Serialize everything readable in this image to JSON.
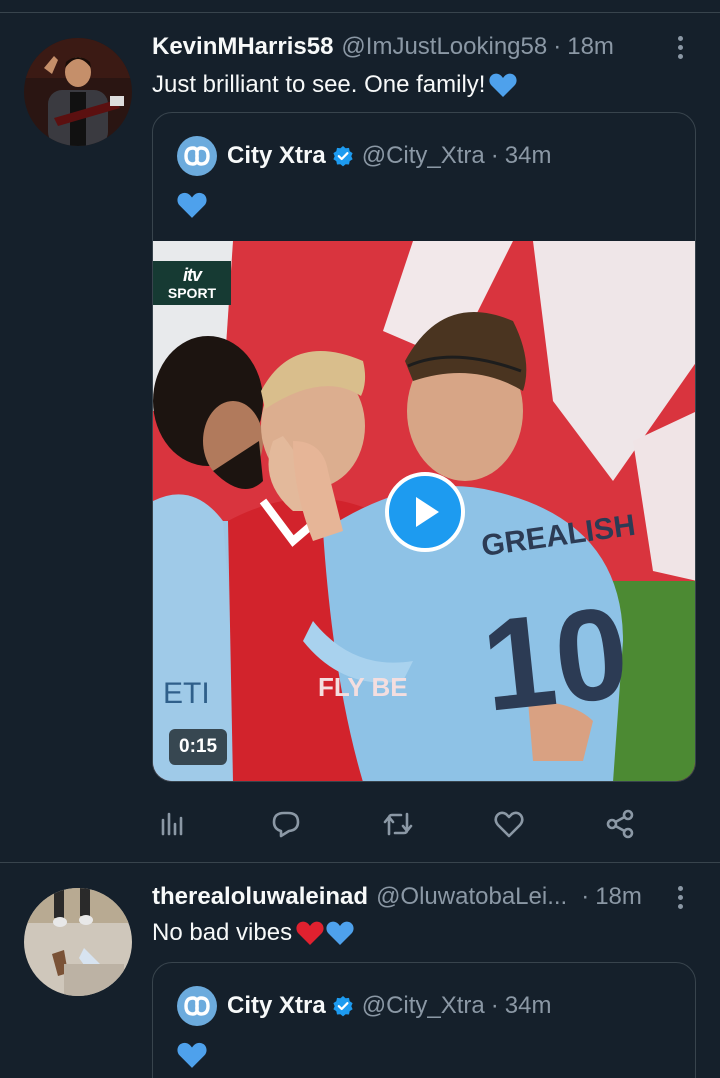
{
  "tweets": [
    {
      "display_name": "KevinMHarris58",
      "handle": "@ImJustLooking58",
      "dot": "·",
      "time": "18m",
      "text": "Just brilliant to see. One family!",
      "emoji": [
        "blue-heart"
      ],
      "quote": {
        "display_name": "City Xtra",
        "handle": "@City_Xtra",
        "dot": "·",
        "time": "34m",
        "emoji": [
          "blue-heart"
        ],
        "media": {
          "broadcaster_logo": "itv",
          "broadcaster_label": "SPORT",
          "duration": "0:15",
          "jersey_name": "GREALISH",
          "jersey_number": "10"
        }
      },
      "actions": [
        "stats-icon",
        "reply-icon",
        "retweet-icon",
        "like-icon",
        "share-icon"
      ]
    },
    {
      "display_name": "therealoluwaleinad",
      "handle": "@OluwatobaLei...",
      "dot": "·",
      "time": "18m",
      "text": "No bad vibes",
      "emoji": [
        "red-heart",
        "blue-heart"
      ],
      "quote": {
        "display_name": "City Xtra",
        "handle": "@City_Xtra",
        "dot": "·",
        "time": "34m",
        "emoji": [
          "blue-heart"
        ]
      }
    }
  ],
  "colors": {
    "background": "#15202b",
    "border": "#38444d",
    "muted_text": "#8b98a5",
    "accent": "#1d9bf0",
    "city_blue": "#6cabdd"
  }
}
